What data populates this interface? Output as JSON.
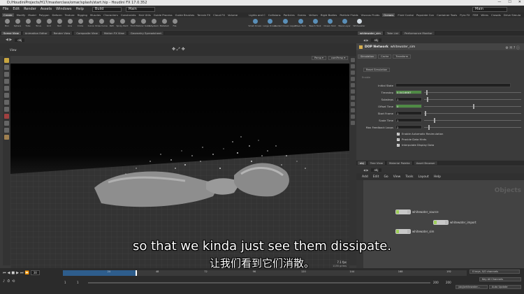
{
  "window": {
    "title": "D:/HoudiniProjects/H17/masterclass/omar/splash/start.hip - Houdini FX 17.0.352",
    "minimize": "—",
    "maximize": "☐",
    "close": "✕"
  },
  "menubar": {
    "items": [
      "File",
      "Edit",
      "Render",
      "Assets",
      "Windows",
      "Help"
    ],
    "build_desk": "Build",
    "main_desk": "Main",
    "right_desk": "Main"
  },
  "shelf_tabs_left": [
    "Create",
    "Modify",
    "Model",
    "Polygon",
    "Deform",
    "Texture",
    "Rigging",
    "Muscles",
    "Characters",
    "Constraints",
    "Hair Utils",
    "Guide Process",
    "Guide Brushes",
    "Terrain FX",
    "Cloud FX",
    "Volume"
  ],
  "shelf_tabs_right": [
    "Lights and C",
    "Collisions",
    "Particles",
    "Grains",
    "Vellum",
    "Rigid Bodies",
    "Particle Fluids",
    "Viscous Fluids",
    "Oceans",
    "Fluid Contai",
    "Populate Con",
    "Container Tools",
    "Pyro FX",
    "FEM",
    "Wires",
    "Crowds",
    "Drive Simula"
  ],
  "shelf_tools_left": [
    "Box",
    "Sphere",
    "Tube",
    "Torus",
    "Grid",
    "Null",
    "Line",
    "Circle",
    "Curve",
    "Draw Curve",
    "Path",
    "Spray Paint",
    "Font",
    "Platonic Solids",
    "L-System",
    "Metaball",
    "File"
  ],
  "shelf_tools_right": [
    "Small Ocean",
    "Large Ocean",
    "Guided Ocean Layer",
    "Wave Tank",
    "Beach Tank",
    "Ocean Tank",
    "Wave Layer",
    "Whitewater"
  ],
  "left_pane_tabs": [
    "Scene View",
    "Animation Editor",
    "Render View",
    "Composite View",
    "Motion FX View",
    "Geometry Spreadsheet"
  ],
  "viewer": {
    "path": "obj",
    "label": "View",
    "persp": "Persp ▾",
    "cam": "camPersp ▾",
    "fps": "7.1 fps",
    "info": "1155 prims"
  },
  "right_top_tabs": [
    "whitewater_sim",
    "Take List",
    "Performance Monitor"
  ],
  "param_pane": {
    "path": "obj",
    "node_type": "DOP Network",
    "node_name": "whitewater_sim",
    "tabs": [
      "Simulation",
      "Cache",
      "Transform"
    ],
    "reset_button": "Reset Simulation",
    "enable": "Enable",
    "rows": [
      {
        "label": "Initial State",
        "value": ""
      },
      {
        "label": "Timestep",
        "value": "0.0416667",
        "green": true
      },
      {
        "label": "Substeps",
        "value": "1"
      },
      {
        "label": "Offset Time",
        "value": "0",
        "green": true
      },
      {
        "label": "Start Frame",
        "value": "1"
      },
      {
        "label": "Scale Time",
        "value": "1"
      },
      {
        "label": "Max Feedback Loops",
        "value": "2"
      }
    ],
    "checks": [
      "Enable Automatic Resimulation",
      "Provide Data Hints",
      "Interpolate Display Data"
    ]
  },
  "network_tabs": [
    "obj",
    "Tree View",
    "Material Palette",
    "Asset Browser"
  ],
  "network": {
    "path": "obj",
    "menu": [
      "Add",
      "Edit",
      "Go",
      "View",
      "Tools",
      "Layout",
      "Help"
    ],
    "context_label": "Objects",
    "nodes": [
      "whitewater_source",
      "whitewater_import",
      "whitewater_sim"
    ]
  },
  "subtitles": {
    "en": "so that we kinda just see them dissipate.",
    "zh": "让我们看到它们消散。"
  },
  "timeline": {
    "frame": "38",
    "start": "1",
    "start2": "1",
    "end": "200",
    "end2": "200",
    "ticks": [
      "24",
      "48",
      "72",
      "96",
      "120",
      "144",
      "168",
      "192"
    ],
    "keys_label": "0 keys, 0/0 channels",
    "key_all": "Key All Channels",
    "auto_update": "Auto Update",
    "path_field": "/obj/whitewater..."
  }
}
